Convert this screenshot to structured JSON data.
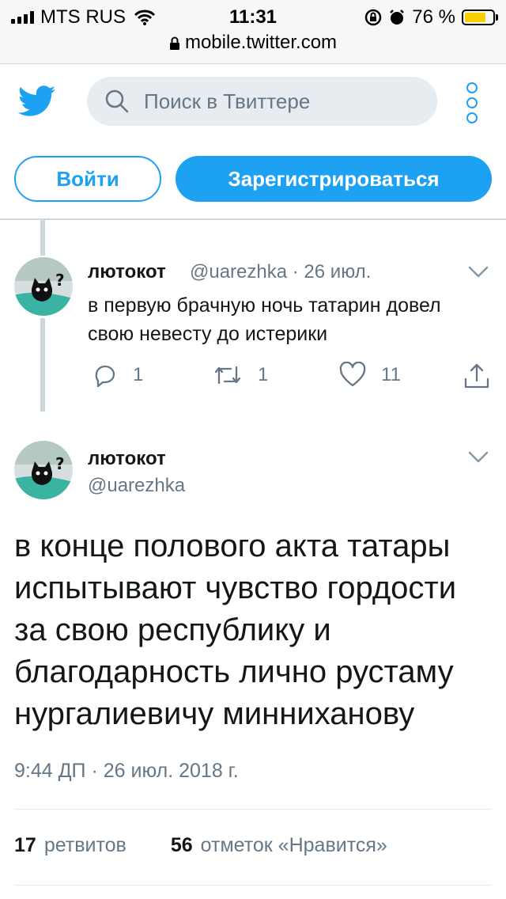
{
  "status_bar": {
    "carrier": "MTS RUS",
    "time": "11:31",
    "battery_percent": "76 %",
    "battery_level": 0.76,
    "url": "mobile.twitter.com"
  },
  "header": {
    "search_placeholder": "Поиск в Твиттере",
    "login_label": "Войти",
    "signup_label": "Зарегистрироваться",
    "accent_color": "#1da1f2"
  },
  "reply_tweet": {
    "name": "лютокот",
    "meta": "@uarezhka · 26 июл.",
    "text": "в первую брачную ночь татарин довел свою невесту до истерики",
    "replies": "1",
    "retweets": "1",
    "likes": "11"
  },
  "main_tweet": {
    "name": "лютокот",
    "handle": "@uarezhka",
    "text": "в конце полового акта татары испытывают чувство гордости за свою республику и благодарность лично рустаму нургалиевичу минниханову",
    "timestamp": "9:44 ДП · 26 июл. 2018 г.",
    "retweet_count": "17",
    "retweet_label": "ретвитов",
    "like_count": "56",
    "like_label": "отметок «Нравится»"
  },
  "icons": [
    "twitter-bird-icon",
    "search-icon",
    "more-dots-icon",
    "chevron-down-icon",
    "reply-icon",
    "retweet-icon",
    "like-icon",
    "share-icon",
    "lock-icon",
    "wifi-icon",
    "alarm-icon",
    "rotation-lock-icon"
  ]
}
